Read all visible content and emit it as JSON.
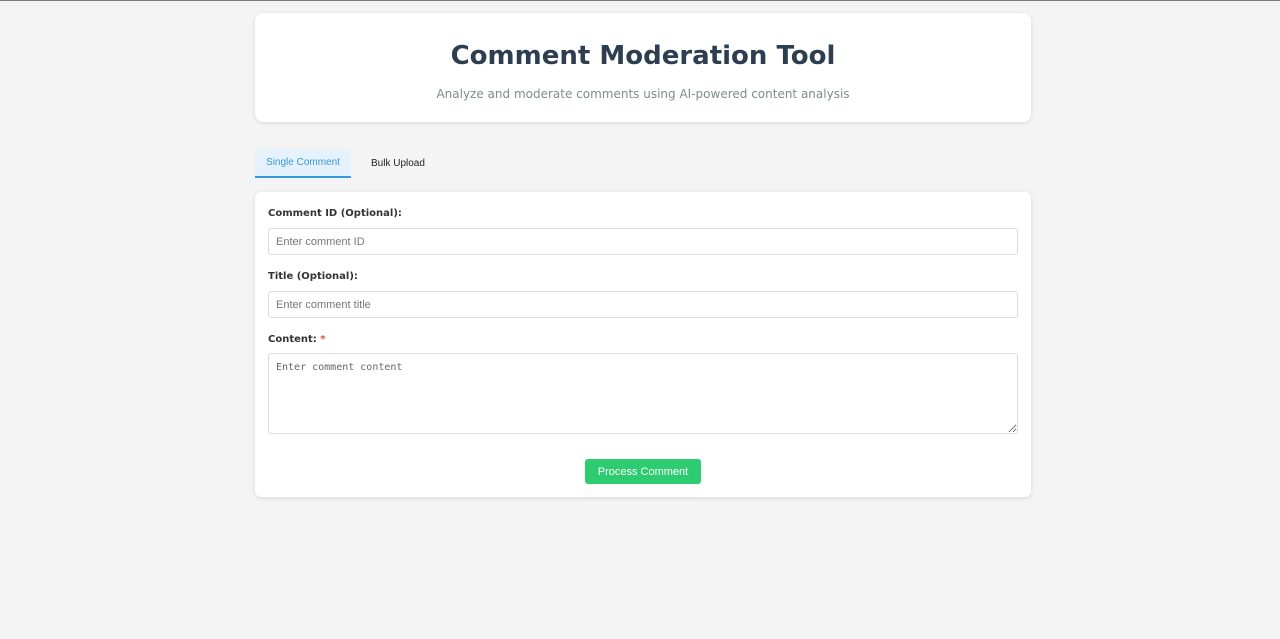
{
  "header": {
    "title": "Comment Moderation Tool",
    "subtitle": "Analyze and moderate comments using AI-powered content analysis"
  },
  "tabs": [
    {
      "label": "Single Comment",
      "active": true
    },
    {
      "label": "Bulk Upload",
      "active": false
    }
  ],
  "form": {
    "comment_id": {
      "label": "Comment ID (Optional):",
      "placeholder": "Enter comment ID",
      "value": ""
    },
    "title": {
      "label": "Title (Optional):",
      "placeholder": "Enter comment title",
      "value": ""
    },
    "content": {
      "label": "Content:",
      "required_marker": "*",
      "placeholder": "Enter comment content",
      "value": ""
    },
    "submit_label": "Process Comment"
  },
  "colors": {
    "background": "#f4f4f4",
    "title": "#2c3e50",
    "accent": "#3498db",
    "submit": "#2ecc71",
    "required": "#e74c3c"
  }
}
